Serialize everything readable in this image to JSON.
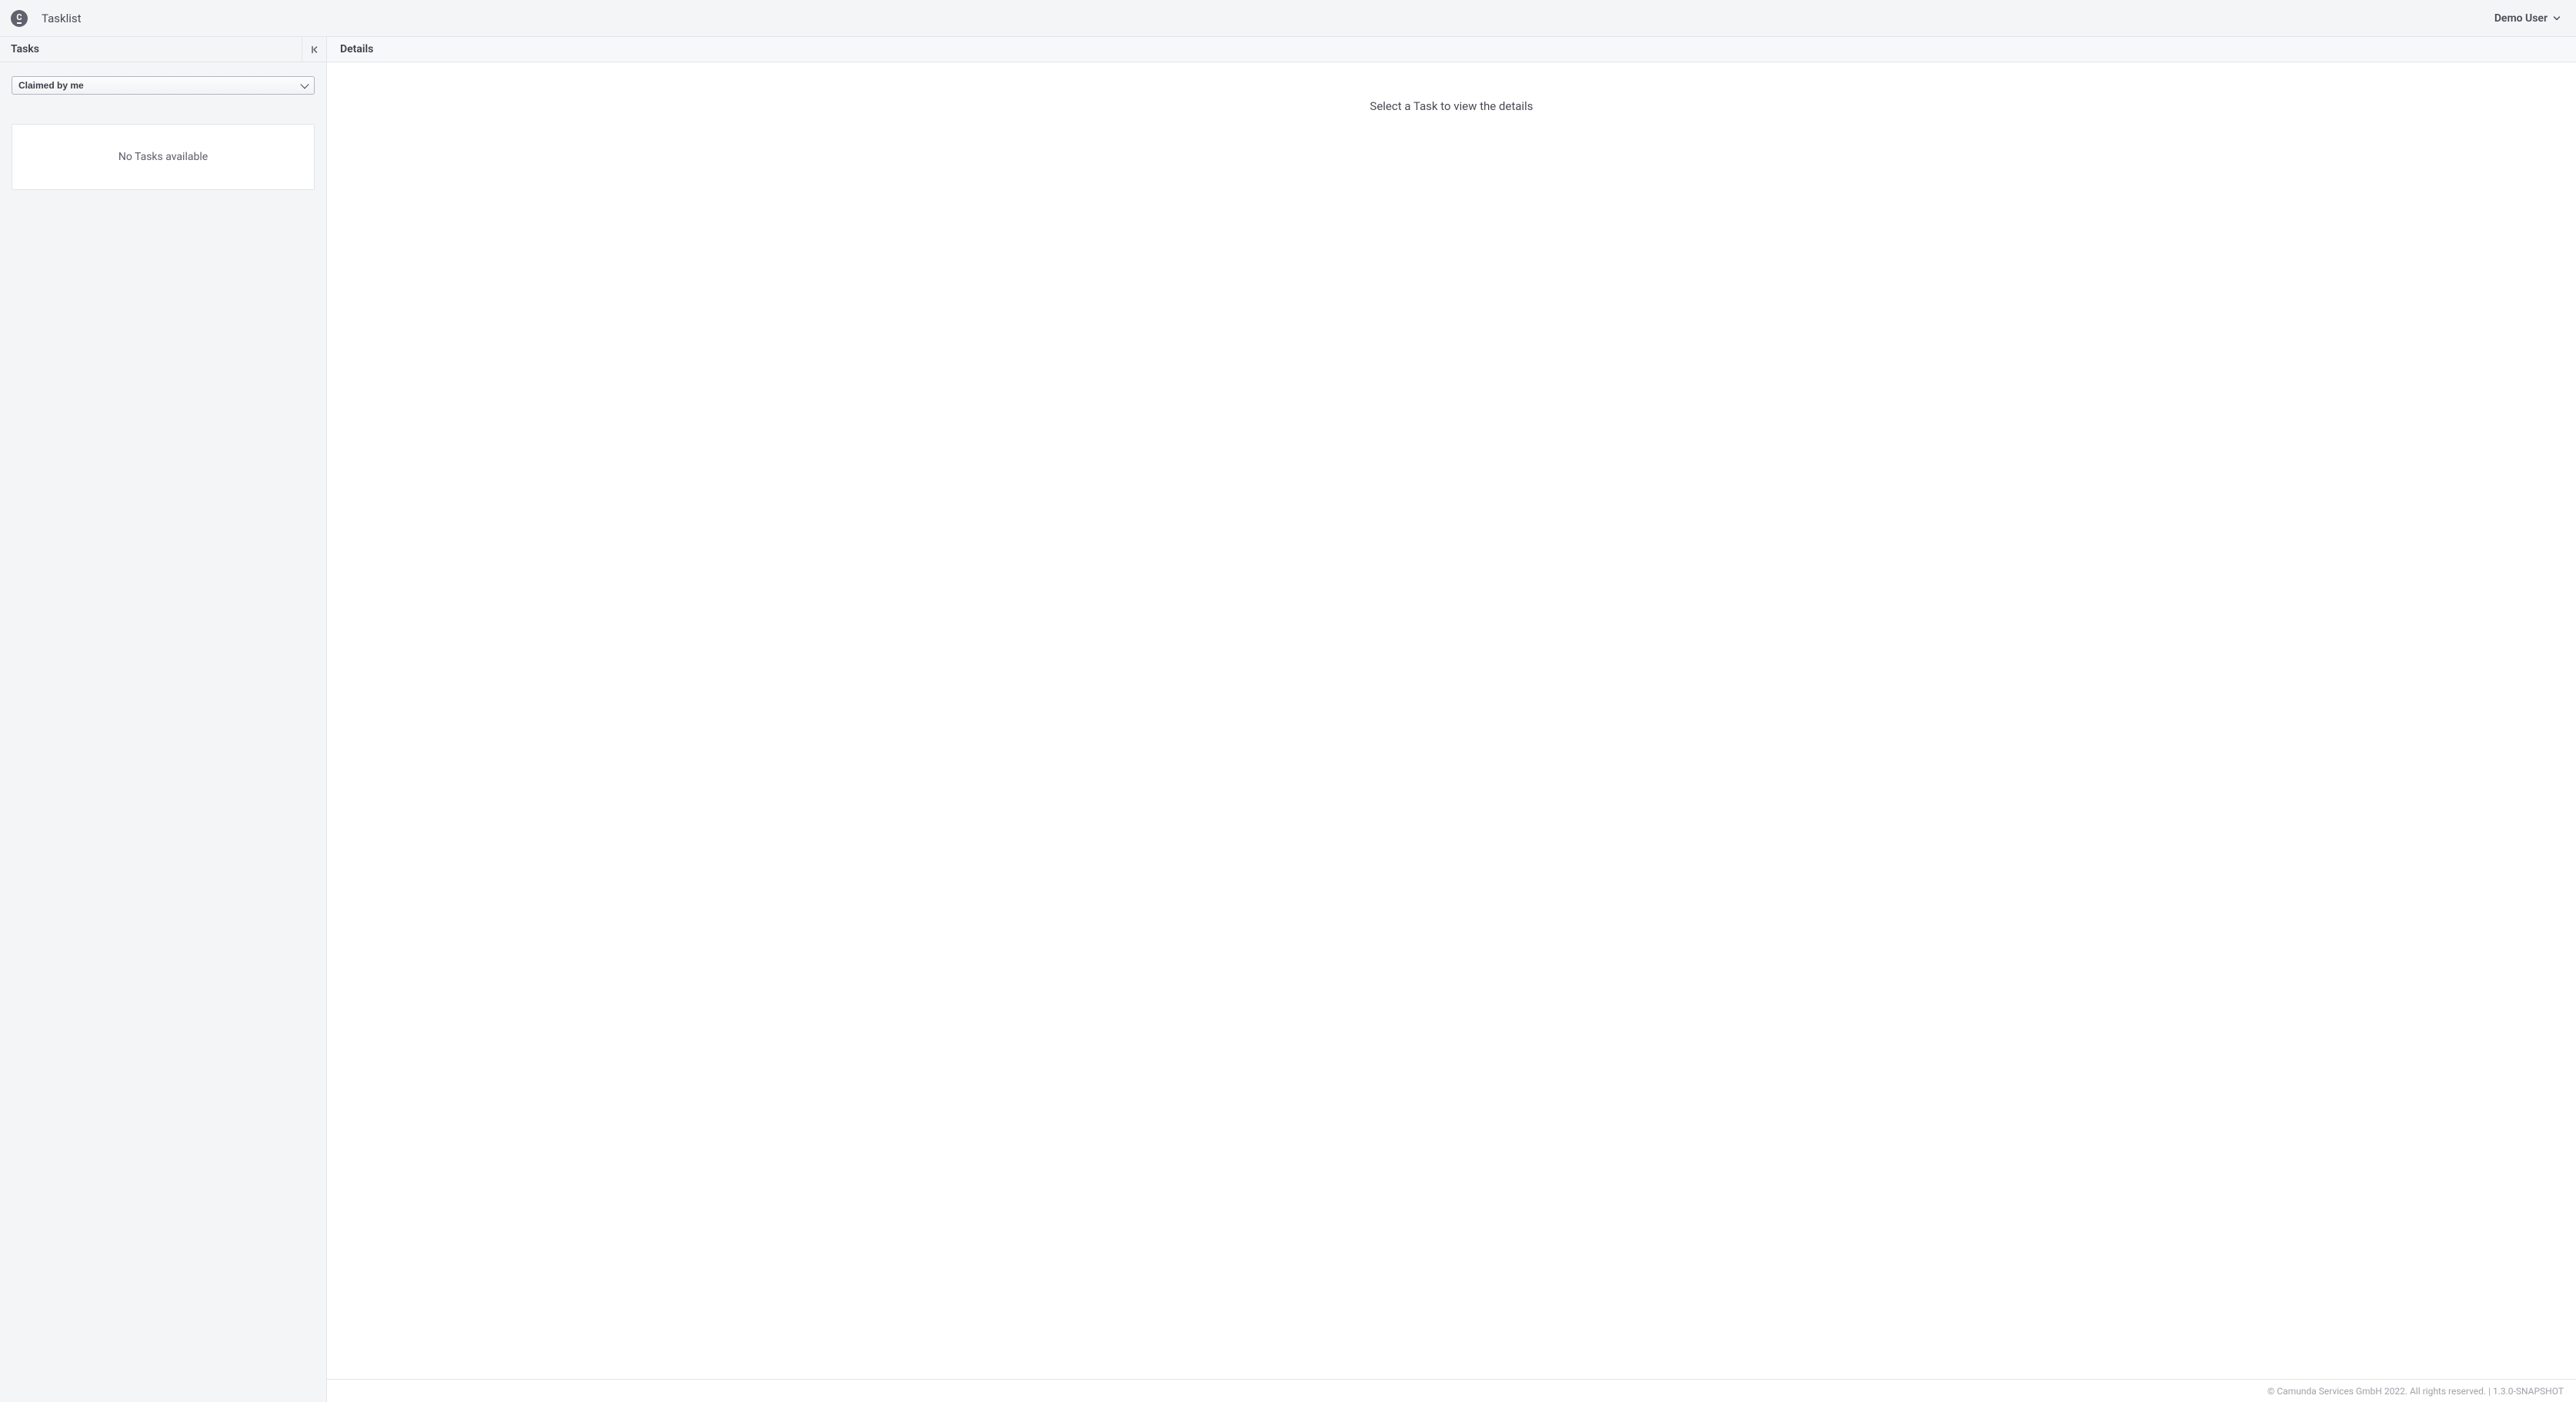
{
  "header": {
    "app_title": "Tasklist",
    "logo_letter": "C",
    "user_name": "Demo User"
  },
  "sidebar": {
    "panel_title": "Tasks",
    "filter_selected": "Claimed by me",
    "empty_message": "No Tasks available"
  },
  "main": {
    "panel_title": "Details",
    "placeholder": "Select a Task to view the details"
  },
  "footer": {
    "text": "© Camunda Services GmbH 2022. All rights reserved. | 1.3.0-SNAPSHOT"
  }
}
